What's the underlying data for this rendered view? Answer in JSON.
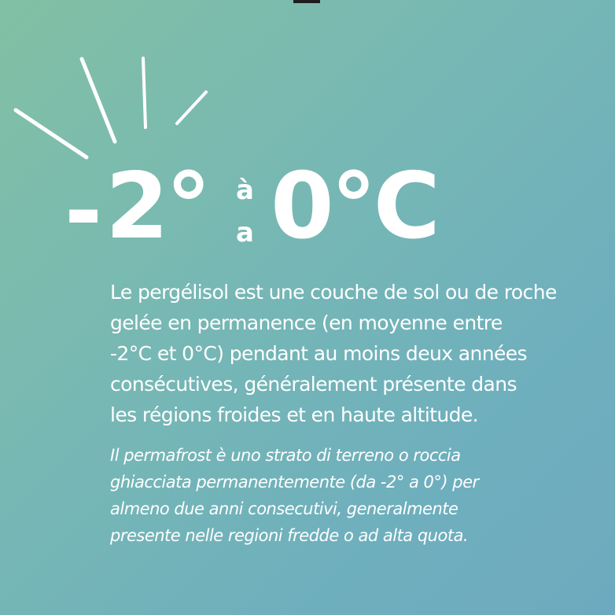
{
  "headline": {
    "minus": "-",
    "from_value": "2°",
    "separator_top": "à",
    "separator_bottom": "a",
    "to_value": "0°C"
  },
  "description_fr": {
    "lines": [
      "Le pergélisol est une couche de sol ou de roche",
      "gelée en permanence (en moyenne entre",
      "-2°C et 0°C) pendant au moins deux années",
      "consécutives, généralement présente dans",
      "les régions froides et en haute altitude."
    ]
  },
  "description_it": {
    "lines": [
      "Il permafrost è uno strato di terreno o roccia",
      "ghiacciata permanentemente (da -2° a 0°) per",
      "almeno due anni consecutivi, generalmente",
      "presente nelle regioni fredde o ad alta quota."
    ]
  },
  "colors": {
    "text": "#ffffff",
    "gradient_start": "#82c0a4",
    "gradient_end": "#6eaabf"
  },
  "icons": [
    "burst-rays-icon"
  ]
}
